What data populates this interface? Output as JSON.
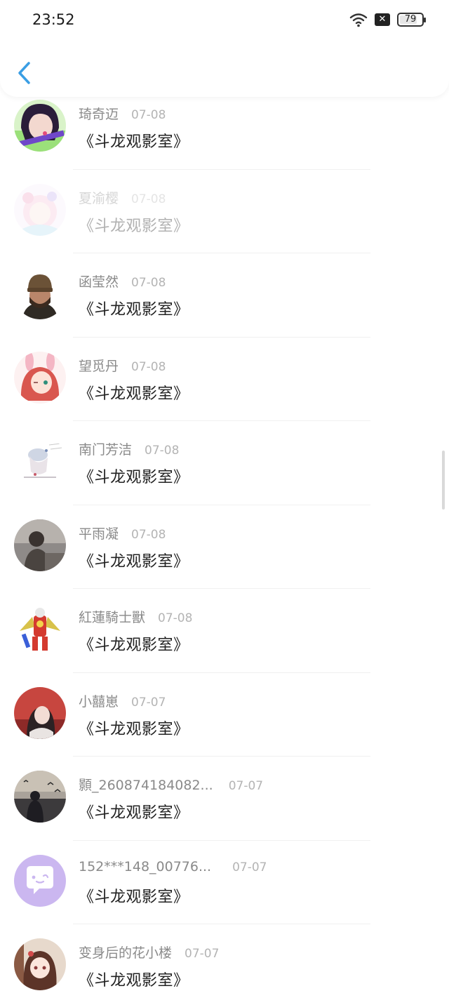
{
  "status_bar": {
    "time": "23:52",
    "battery": "79",
    "battery_level": 0.79,
    "sim_label": "✕"
  },
  "items": [
    {
      "name": "琦奇迈",
      "date": "07-08",
      "title": "《斗龙观影室》",
      "avatar": "anime-girl-dark-hair"
    },
    {
      "name": "夏渝樱",
      "date": "07-08",
      "title": "《斗龙观影室》",
      "avatar": "anime-girl-pastel"
    },
    {
      "name": "函莹然",
      "date": "07-08",
      "title": "《斗龙观影室》",
      "avatar": "man-beanie"
    },
    {
      "name": "望觅丹",
      "date": "07-08",
      "title": "《斗龙观影室》",
      "avatar": "anime-girl-bunny"
    },
    {
      "name": "南门芳洁",
      "date": "07-08",
      "title": "《斗龙观影室》",
      "avatar": "sketch-figure"
    },
    {
      "name": "平雨凝",
      "date": "07-08",
      "title": "《斗龙观影室》",
      "avatar": "person-grey-photo"
    },
    {
      "name": "紅蓮騎士獸",
      "date": "07-08",
      "title": "《斗龙观影室》",
      "avatar": "red-knight-robot"
    },
    {
      "name": "小囍崽",
      "date": "07-07",
      "title": "《斗龙观影室》",
      "avatar": "girl-red-background"
    },
    {
      "name": "顥_260874184082...",
      "date": "07-07",
      "title": "《斗龙观影室》",
      "avatar": "sunset-birds"
    },
    {
      "name": "152***148_00776...",
      "date": "07-07",
      "title": "《斗龙观影室》",
      "avatar": "chat-bubble-default"
    },
    {
      "name": "变身后的花小楼",
      "date": "07-07",
      "title": "《斗龙观影室》",
      "avatar": "anime-girl-brown-hair"
    }
  ]
}
